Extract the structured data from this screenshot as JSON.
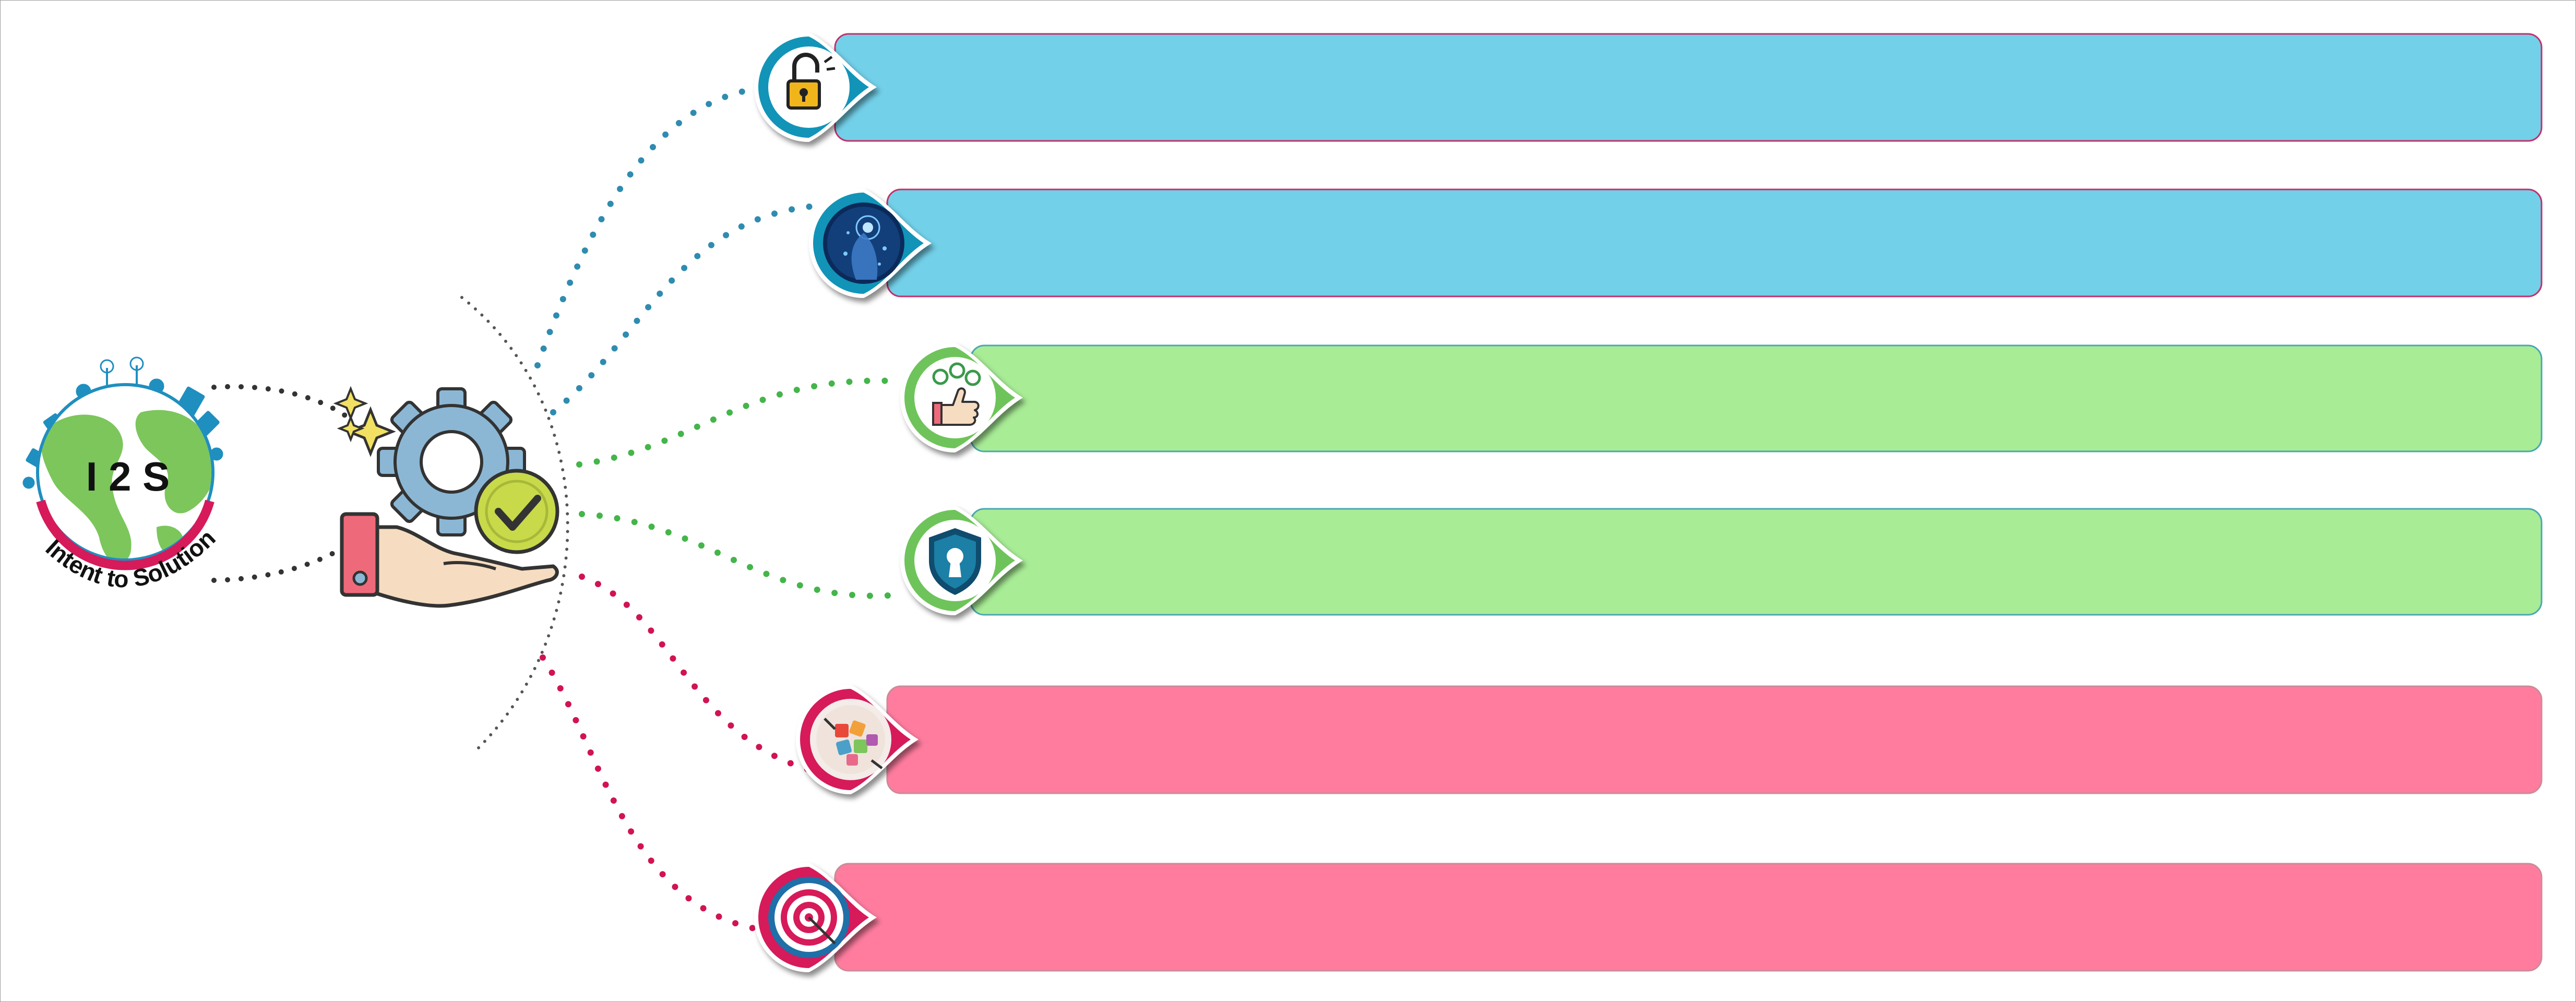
{
  "logo": {
    "mark": "I 2 S",
    "caption": "Intent to Solution"
  },
  "colors": {
    "blue_bar": "#72d0e9",
    "blue_accent": "#1294b8",
    "blue_dots": "#2f8cb0",
    "green_bar": "#a8ec96",
    "green_accent": "#6ec45a",
    "green_dots": "#44b54a",
    "pink_bar": "#ff7c9f",
    "pink_accent": "#d61a5a",
    "pink_dots": "#d11451",
    "dark_dots": "#333333",
    "globe_ocean": "#ffffff",
    "globe_land": "#7cc65c",
    "gear": "#8bb7d4",
    "check": "#c8d94a",
    "hand": "#f6dcc0",
    "cuff": "#ee6a7a"
  },
  "items": [
    {
      "id": "unlock",
      "icon": "unlock-icon",
      "group": "blue"
    },
    {
      "id": "tech",
      "icon": "digital-touch-icon",
      "group": "blue"
    },
    {
      "id": "ideas",
      "icon": "thumbs-up-ideas-icon",
      "group": "green"
    },
    {
      "id": "secure",
      "icon": "security-shield-icon",
      "group": "green"
    },
    {
      "id": "puzzle",
      "icon": "puzzle-pieces-icon",
      "group": "pink"
    },
    {
      "id": "target",
      "icon": "target-icon",
      "group": "pink"
    }
  ]
}
